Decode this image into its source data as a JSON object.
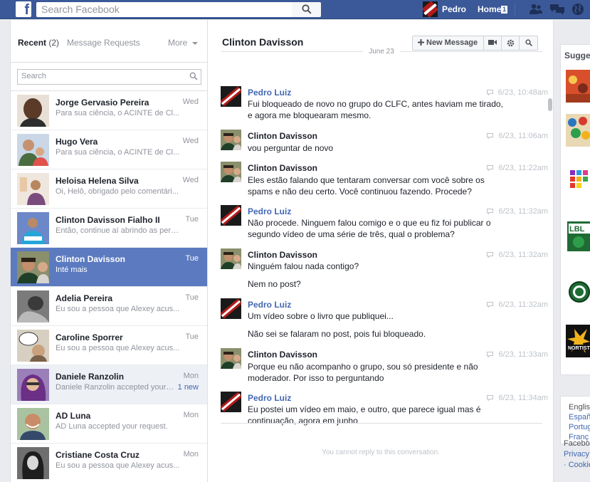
{
  "topbar": {
    "logo": "f",
    "search_placeholder": "Search Facebook",
    "user_name": "Pedro",
    "home_label": "Home",
    "home_count": "1"
  },
  "left": {
    "tab_recent": "Recent",
    "tab_recent_count": "(2)",
    "tab_requests": "Message Requests",
    "tab_more": "More",
    "search_placeholder": "Search",
    "threads": [
      {
        "name": "Jorge Gervasio Pereira",
        "snippet": "Para sua ciência, o ACINTE de Cl...",
        "time": "Wed"
      },
      {
        "name": "Hugo Vera",
        "snippet": "Para sua ciência, o ACINTE de Cl...",
        "time": "Wed"
      },
      {
        "name": "Heloisa Helena Silva",
        "snippet": "Oi, Helô, obrigado pelo comentári...",
        "time": "Wed"
      },
      {
        "name": "Clinton Davisson Fialho II",
        "snippet": "Então, continue aí abrindo as pern...",
        "time": "Tue"
      },
      {
        "name": "Clinton Davisson",
        "snippet": "Inté mais",
        "time": "Tue"
      },
      {
        "name": "Adelia Pereira",
        "snippet": "Eu sou a pessoa que Alexey acus...",
        "time": "Tue"
      },
      {
        "name": "Caroline Sporrer",
        "snippet": "Eu sou a pessoa que Alexey acus...",
        "time": "Tue"
      },
      {
        "name": "Daniele Ranzolin",
        "snippet": "Daniele Ranzolin accepted your r...",
        "time": "Mon",
        "badge": "1 new"
      },
      {
        "name": "AD Luna",
        "snippet": "AD Luna accepted your request.",
        "time": "Mon"
      },
      {
        "name": "Cristiane Costa Cruz",
        "snippet": "Eu sou a pessoa que Alexey acus...",
        "time": "Mon"
      }
    ]
  },
  "conversation": {
    "title": "Clinton Davisson",
    "new_message_label": "New Message",
    "date_divider": "June 23",
    "messages": [
      {
        "sender": "Pedro Luiz",
        "time": "6/23, 10:48am",
        "lines": [
          "Fui bloqueado de novo no grupo do CLFC, antes haviam me tirado, e agora me bloquearam mesmo."
        ]
      },
      {
        "sender": "Clinton Davisson",
        "time": "6/23, 11:06am",
        "lines": [
          "vou perguntar de novo"
        ]
      },
      {
        "sender": "Clinton Davisson",
        "time": "6/23, 11:22am",
        "lines": [
          "Eles estão falando que tentaram conversar com você sobre os spams e não deu certo. Você continuou fazendo. Procede?"
        ]
      },
      {
        "sender": "Pedro Luiz",
        "time": "6/23, 11:32am",
        "lines": [
          "Não procede. Ninguem falou comigo e o que eu fiz foi publicar o segundo vídeo de uma série de três, qual o problema?"
        ]
      },
      {
        "sender": "Clinton Davisson",
        "time": "6/23, 11:32am",
        "lines": [
          "Ninguém falou nada contigo?",
          "Nem no post?"
        ]
      },
      {
        "sender": "Pedro Luiz",
        "time": "6/23, 11:32am",
        "lines": [
          "Um vídeo sobre o livro que publiquei...",
          "Não sei se falaram no post, pois fui bloqueado."
        ]
      },
      {
        "sender": "Clinton Davisson",
        "time": "6/23, 11:33am",
        "lines": [
          "Porque eu não acompanho o grupo, sou só presidente e não moderador.  Por isso to perguntando"
        ]
      },
      {
        "sender": "Pedro Luiz",
        "time": "6/23, 11:34am",
        "lines": [
          "Eu postei um vídeo em maio, e outro, que parece igual mas é continuação, agora em junho"
        ]
      }
    ],
    "cannot_reply": "You cannot reply to this conversation."
  },
  "right": {
    "suggested_title": "Sugges",
    "languages": [
      "Englis",
      "Españ",
      "Portug",
      "Franç"
    ],
    "footer_title": "Facebo",
    "footer_links": [
      "Privacy",
      "· Cookie"
    ]
  },
  "colors": {
    "brand": "#3b5998",
    "active_thread": "#5b7ac0",
    "link": "#4267b2"
  }
}
